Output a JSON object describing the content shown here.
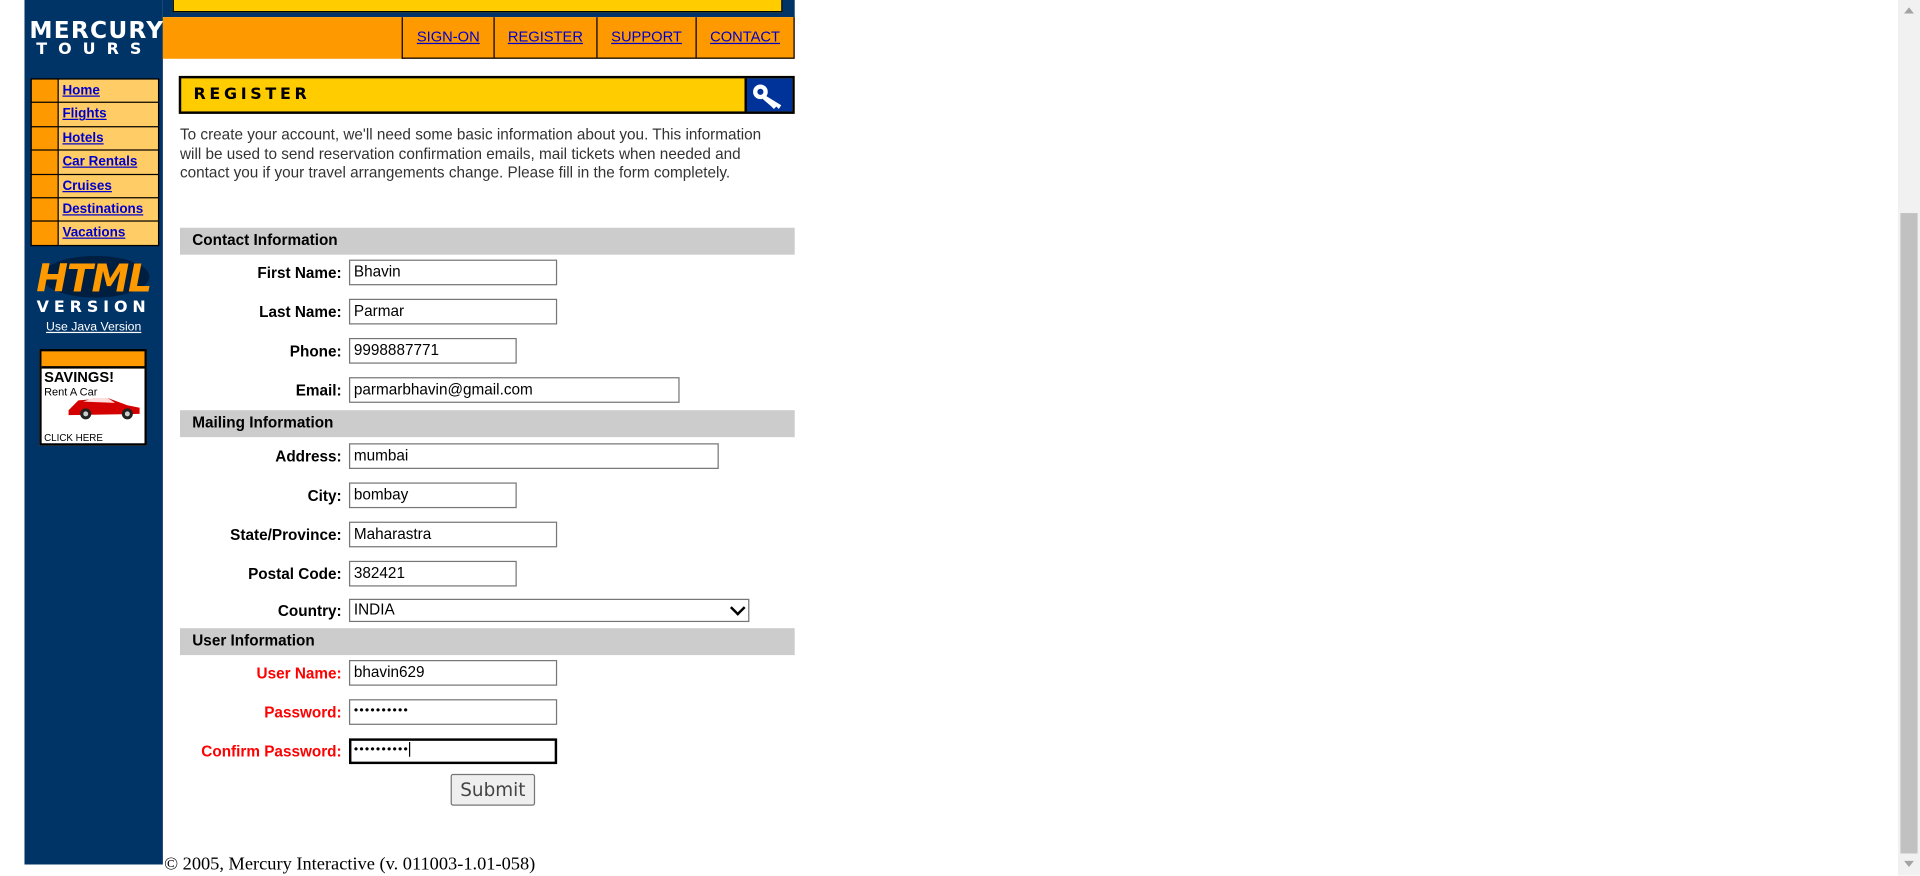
{
  "brand": {
    "line1": "MERCURY",
    "line2": "TOURS"
  },
  "topnav": [
    "SIGN-ON",
    "REGISTER",
    "SUPPORT",
    "CONTACT"
  ],
  "sidebar": {
    "nav": [
      "Home",
      "Flights",
      "Hotels",
      "Car Rentals",
      "Cruises",
      "Destinations",
      "Vacations"
    ],
    "html_version_title": "HTML",
    "html_version_sub": "VERSION",
    "java_link": "Use Java Version",
    "promo": {
      "headline": "SAVINGS!",
      "sub": "Rent A Car",
      "cta": "CLICK HERE"
    }
  },
  "page": {
    "title": "REGISTER",
    "title_icon": "key-icon",
    "intro": "To create your account, we'll need some basic information about you. This information will be used to send reservation confirmation emails, mail tickets when needed and contact you if your travel arrangements change. Please fill in the form completely."
  },
  "form": {
    "contact_header": "Contact Information",
    "first_name": {
      "label": "First Name:",
      "value": "Bhavin"
    },
    "last_name": {
      "label": "Last Name:",
      "value": "Parmar"
    },
    "phone": {
      "label": "Phone:",
      "value": "9998887771"
    },
    "email": {
      "label": "Email:",
      "value": "parmarbhavin@gmail.com"
    },
    "mailing_header": "Mailing Information",
    "address": {
      "label": "Address:",
      "value": "mumbai"
    },
    "city": {
      "label": "City:",
      "value": "bombay"
    },
    "state": {
      "label": "State/Province:",
      "value": "Maharastra"
    },
    "postal": {
      "label": "Postal Code:",
      "value": "382421"
    },
    "country": {
      "label": "Country:",
      "value": "INDIA"
    },
    "user_header": "User Information",
    "username": {
      "label": "User Name:",
      "value": "bhavin629"
    },
    "password": {
      "label": "Password:",
      "value": "••••••••••"
    },
    "confirm": {
      "label": "Confirm Password:",
      "value": "••••••••••"
    },
    "submit": "Submit"
  },
  "footer": "© 2005, Mercury Interactive (v. 011003-1.01-058)",
  "colors": {
    "nav_blue": "#003366",
    "accent_orange": "#ff9900",
    "banner_yellow": "#ffcc00",
    "required_red": "#ff0000"
  }
}
